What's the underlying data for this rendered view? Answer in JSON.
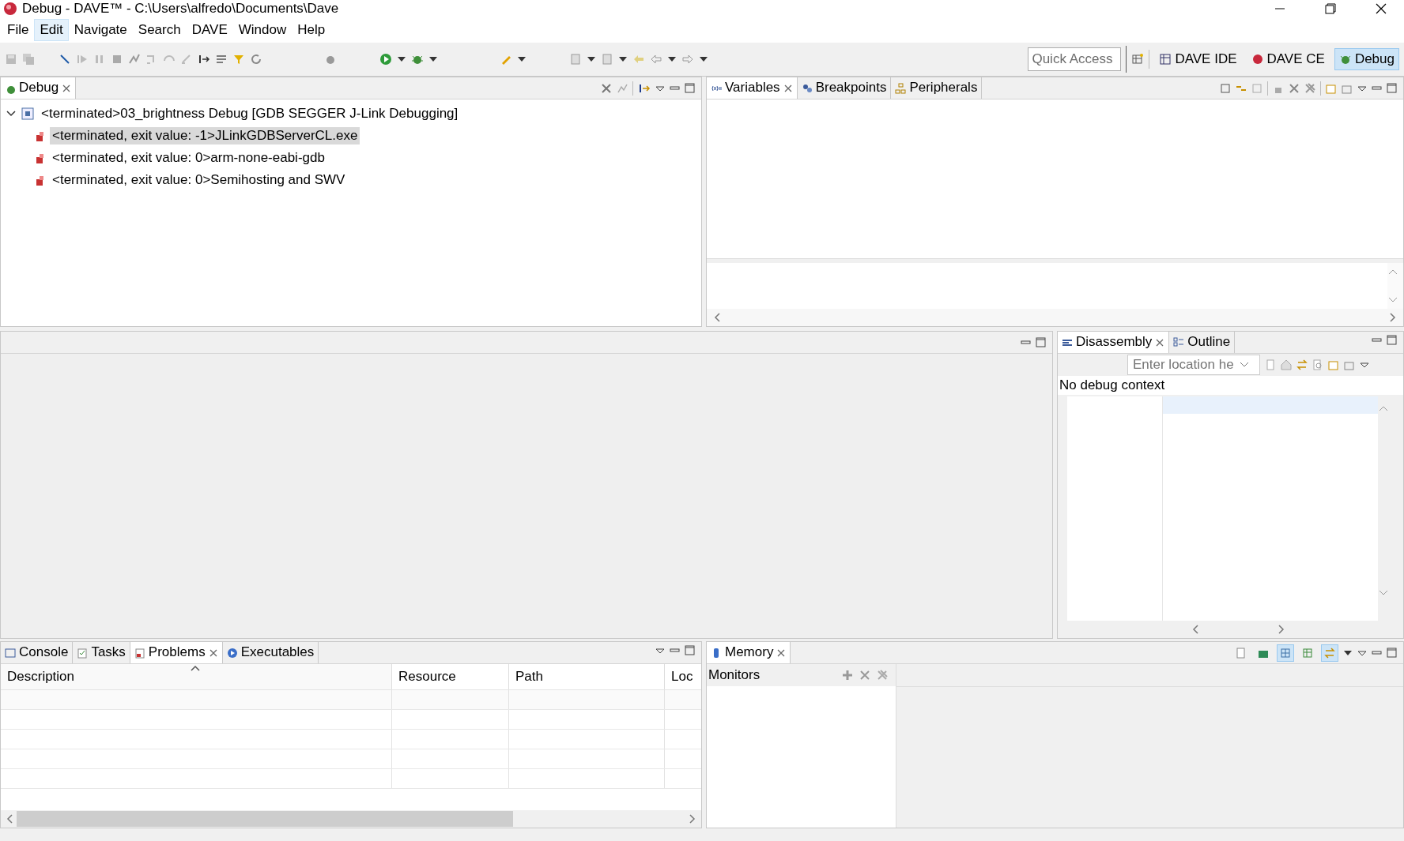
{
  "window": {
    "title": "Debug - DAVE™ - C:\\Users\\alfredo\\Documents\\Dave"
  },
  "menu": [
    {
      "label": "File",
      "selected": false
    },
    {
      "label": "Edit",
      "selected": true
    },
    {
      "label": "Navigate",
      "selected": false
    },
    {
      "label": "Search",
      "selected": false
    },
    {
      "label": "DAVE",
      "selected": false
    },
    {
      "label": "Window",
      "selected": false
    },
    {
      "label": "Help",
      "selected": false
    }
  ],
  "quick_access": {
    "placeholder": "Quick Access"
  },
  "perspectives": [
    {
      "label": "DAVE IDE",
      "selected": false
    },
    {
      "label": "DAVE CE",
      "selected": false
    },
    {
      "label": "Debug",
      "selected": true
    }
  ],
  "debug_view": {
    "tabs": [
      {
        "label": "Debug",
        "selected": true
      }
    ],
    "tree": [
      {
        "label": "<terminated>03_brightness Debug [GDB SEGGER J-Link Debugging]",
        "expanded": true,
        "selected": false,
        "children": [
          {
            "label": "<terminated, exit value: -1>JLinkGDBServerCL.exe",
            "selected": true
          },
          {
            "label": "<terminated, exit value: 0>arm-none-eabi-gdb",
            "selected": false
          },
          {
            "label": "<terminated, exit value: 0>Semihosting and SWV",
            "selected": false
          }
        ]
      }
    ]
  },
  "variables_view": {
    "tabs": [
      {
        "label": "Variables",
        "selected": true
      },
      {
        "label": "Breakpoints",
        "selected": false
      },
      {
        "label": "Peripherals",
        "selected": false
      }
    ]
  },
  "disassembly_view": {
    "tabs": [
      {
        "label": "Disassembly",
        "selected": true
      },
      {
        "label": "Outline",
        "selected": false
      }
    ],
    "location": {
      "placeholder": "Enter location he"
    },
    "message": "No debug context"
  },
  "problems_view": {
    "tabs": [
      {
        "label": "Console",
        "selected": false
      },
      {
        "label": "Tasks",
        "selected": false
      },
      {
        "label": "Problems",
        "selected": true
      },
      {
        "label": "Executables",
        "selected": false
      }
    ],
    "columns": [
      {
        "label": "Description",
        "sorted": true
      },
      {
        "label": "Resource",
        "sorted": false
      },
      {
        "label": "Path",
        "sorted": false
      },
      {
        "label": "Loc",
        "sorted": false
      }
    ]
  },
  "memory_view": {
    "tabs": [
      {
        "label": "Memory",
        "selected": true
      }
    ],
    "toolbar": [
      {
        "on": false
      },
      {
        "on": false
      },
      {
        "on": true
      },
      {
        "on": false
      },
      {
        "on": true
      }
    ],
    "monitors_label": "Monitors"
  }
}
